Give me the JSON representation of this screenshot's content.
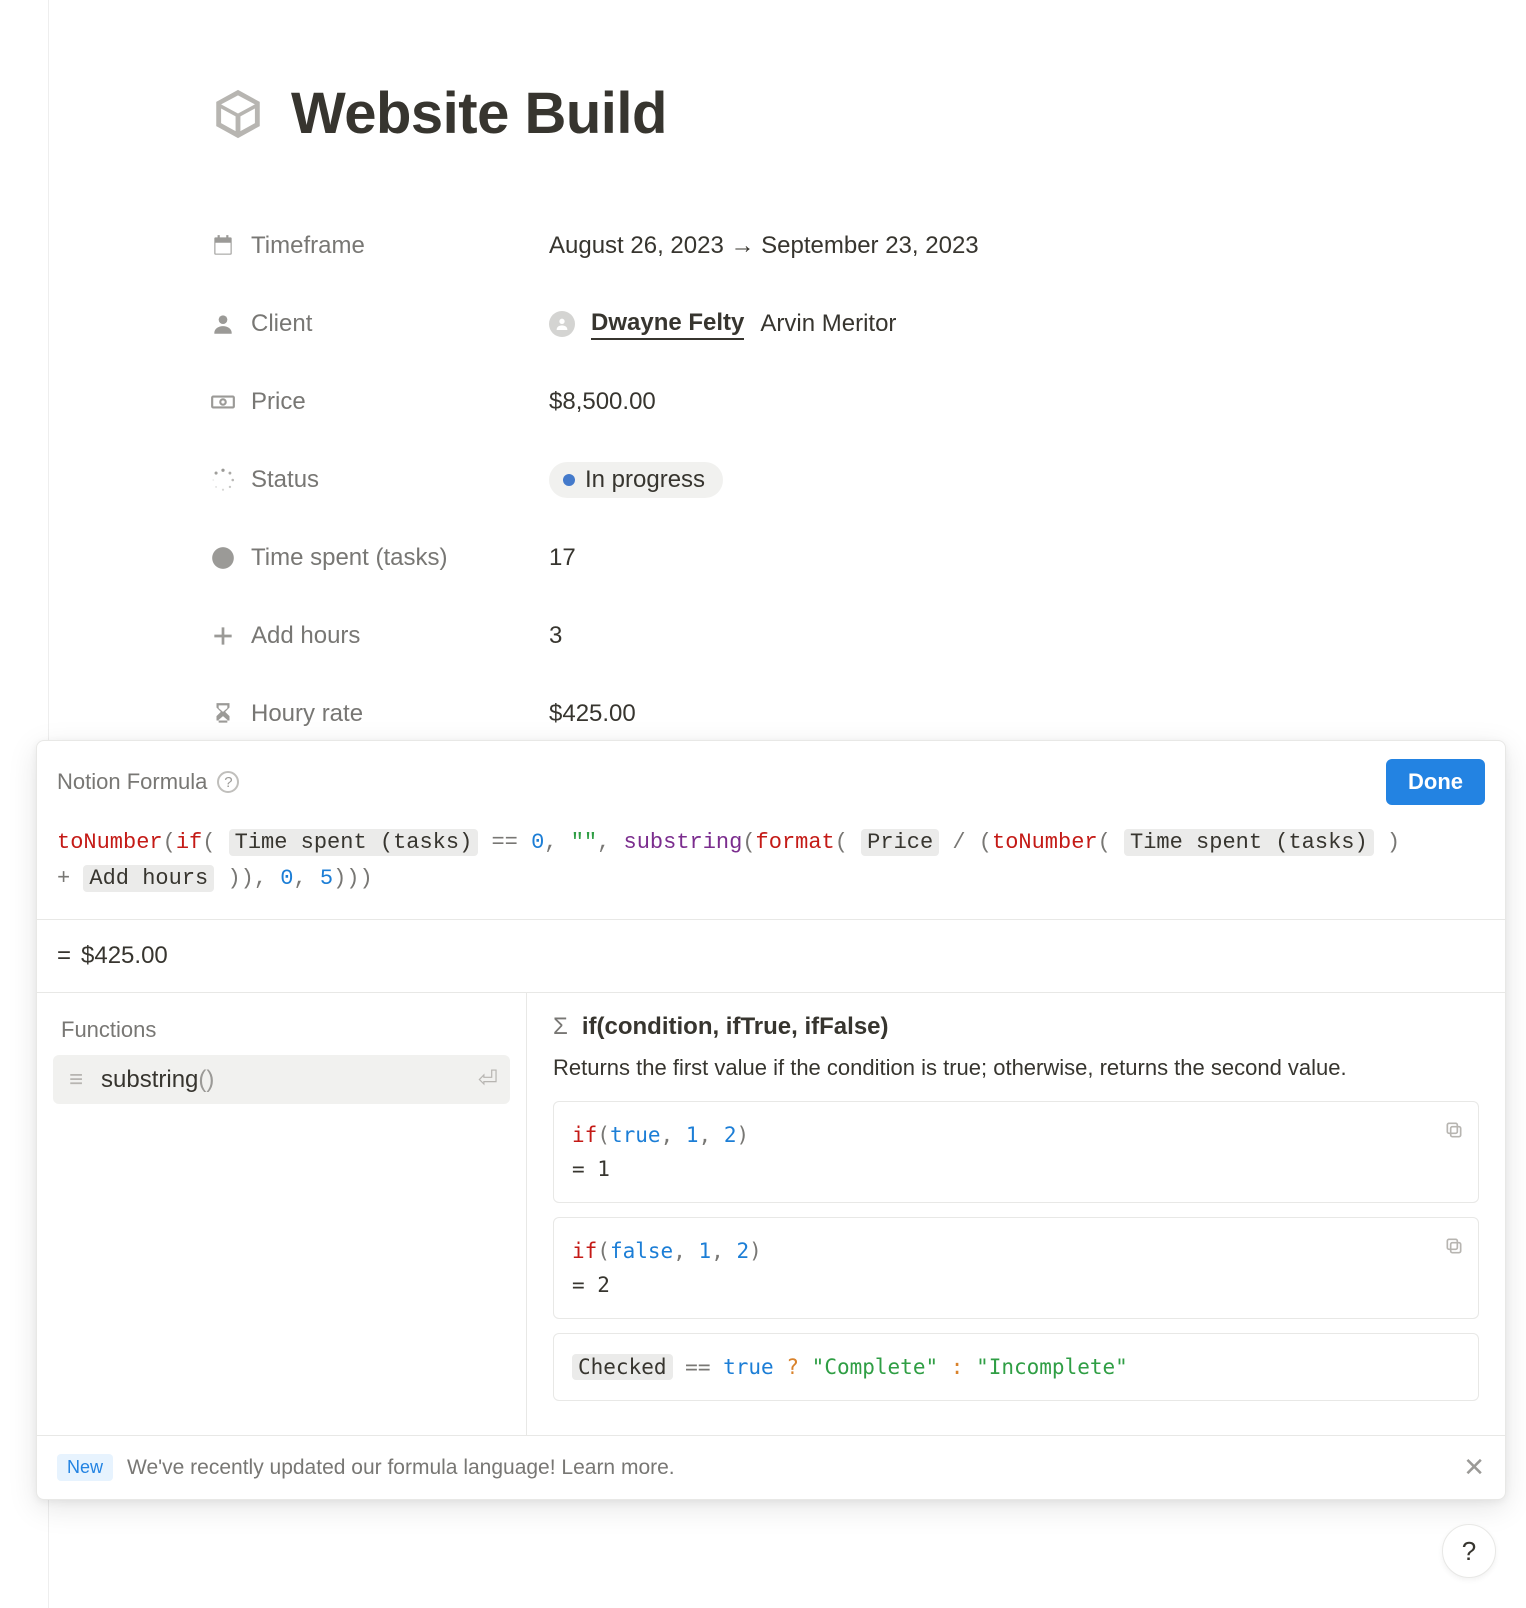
{
  "page": {
    "title": "Website Build"
  },
  "properties": {
    "timeframe": {
      "label": "Timeframe",
      "value": "August 26, 2023 → September 23, 2023"
    },
    "client": {
      "label": "Client",
      "name": "Dwayne Felty",
      "company": "Arvin Meritor"
    },
    "price": {
      "label": "Price",
      "value": "$8,500.00"
    },
    "status": {
      "label": "Status",
      "value": "In progress"
    },
    "time_spent": {
      "label": "Time spent (tasks)",
      "value": "17"
    },
    "add_hours": {
      "label": "Add hours",
      "value": "3"
    },
    "hourly_rate": {
      "label": "Houry rate",
      "value": "$425.00"
    }
  },
  "formula_editor": {
    "title": "Notion Formula",
    "done_label": "Done",
    "result": "$425.00",
    "tokens": {
      "prop_time_spent": "Time spent (tasks)",
      "prop_price": "Price",
      "prop_add_hours": "Add hours"
    },
    "functions_heading": "Functions",
    "selected_function": "substring",
    "doc": {
      "signature": "if(condition, ifTrue, ifFalse)",
      "description": "Returns the first value if the condition is true; otherwise, returns the second value.",
      "example1_code": "if(true, 1, 2)",
      "example1_result": "= 1",
      "example2_code": "if(false, 1, 2)",
      "example2_result": "= 2",
      "example3_prop": "Checked",
      "example3_true": "\"Complete\"",
      "example3_false": "\"Incomplete\""
    }
  },
  "banner": {
    "badge": "New",
    "text": "We've recently updated our formula language! Learn more."
  }
}
